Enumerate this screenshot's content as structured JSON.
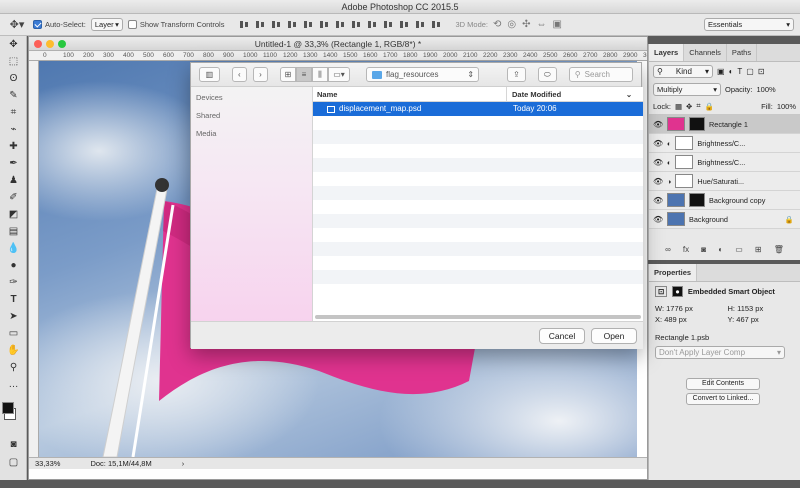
{
  "app_title": "Adobe Photoshop CC 2015.5",
  "options_bar": {
    "auto_select_label": "Auto-Select:",
    "auto_select_checked": true,
    "target_value": "Layer",
    "transform_controls_label": "Show Transform Controls",
    "transform_controls_checked": false,
    "mode_3d_label": "3D Mode:",
    "workspace_value": "Essentials"
  },
  "tools": [
    "move-tool",
    "marquee-tool",
    "lasso-tool",
    "quick-select-tool",
    "crop-tool",
    "eyedropper-tool",
    "healing-tool",
    "brush-tool",
    "stamp-tool",
    "history-brush-tool",
    "eraser-tool",
    "gradient-tool",
    "blur-tool",
    "dodge-tool",
    "pen-tool",
    "type-tool",
    "path-select-tool",
    "shape-tool",
    "hand-tool",
    "zoom-tool"
  ],
  "document": {
    "title": "Untitled-1 @ 33,3% (Rectangle 1, RGB/8*) *",
    "ruler_ticks": [
      "0",
      "100",
      "200",
      "300",
      "400",
      "500",
      "600",
      "700",
      "800",
      "900",
      "1000",
      "1100",
      "1200",
      "1300",
      "1400",
      "1500",
      "1600",
      "1700",
      "1800",
      "1900",
      "2000",
      "2100",
      "2200",
      "2300",
      "2400",
      "2500",
      "2600",
      "2700",
      "2800",
      "2900",
      "3000"
    ],
    "zoom": "33,33%",
    "doc_size": "Doc: 15,1M/44,8M"
  },
  "dialog": {
    "location": "flag_resources",
    "search_placeholder": "Search",
    "sidebar": [
      "Devices",
      "Shared",
      "Media"
    ],
    "col_name": "Name",
    "col_date": "Date Modified",
    "files": [
      {
        "name": "displacement_map.psd",
        "date": "Today 20:06",
        "selected": true
      }
    ],
    "cancel_label": "Cancel",
    "open_label": "Open"
  },
  "layers_panel": {
    "tabs": [
      "Layers",
      "Channels",
      "Paths"
    ],
    "kind_label": "Kind",
    "blend_mode": "Multiply",
    "opacity_label": "Opacity:",
    "opacity_value": "100%",
    "lock_label": "Lock:",
    "fill_label": "Fill:",
    "fill_value": "100%",
    "layers": [
      {
        "name": "Rectangle 1",
        "active": true
      },
      {
        "name": "Brightness/C...",
        "active": false
      },
      {
        "name": "Brightness/C...",
        "active": false
      },
      {
        "name": "Hue/Saturati...",
        "active": false
      },
      {
        "name": "Background copy",
        "active": false
      },
      {
        "name": "Background",
        "active": false
      }
    ]
  },
  "properties_panel": {
    "tab": "Properties",
    "object_type": "Embedded Smart Object",
    "w_label": "W:",
    "w_value": "1776 px",
    "h_label": "H:",
    "h_value": "1153 px",
    "x_label": "X:",
    "x_value": "489 px",
    "y_label": "Y:",
    "y_value": "467 px",
    "file_name": "Rectangle 1.psb",
    "layer_comp": "Don't Apply Layer Comp",
    "edit_contents": "Edit Contents",
    "convert_linked": "Convert to Linked..."
  },
  "colors": {
    "flag": "#e0338f",
    "selection": "#1a6cd8",
    "folder": "#5aa7e8"
  }
}
